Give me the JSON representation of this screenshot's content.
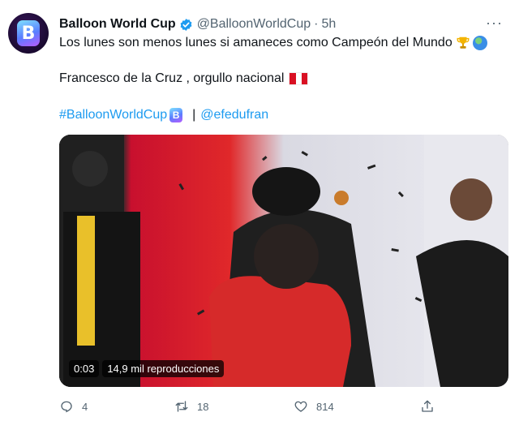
{
  "tweet": {
    "display_name": "Balloon World Cup",
    "handle": "@BalloonWorldCup",
    "separator": "·",
    "time": "5h",
    "more_label": "···",
    "avatar_letter": "B",
    "line1": "Los lunes son menos lunes si amaneces como Campeón del Mundo",
    "line2": "Francesco de la Cruz , orgullo nacional",
    "hashtag": "#BalloonWorldCup",
    "hash_badge": "B",
    "pipe": "|",
    "mention": "@efedufran"
  },
  "media": {
    "duration": "0:03",
    "views": "14,9 mil reproducciones"
  },
  "actions": {
    "replies": "4",
    "retweets": "18",
    "likes": "814"
  },
  "colors": {
    "link": "#1d9bf0",
    "verified": "#1d9bf0",
    "muted": "#536471",
    "flag_red": "#d91023"
  }
}
